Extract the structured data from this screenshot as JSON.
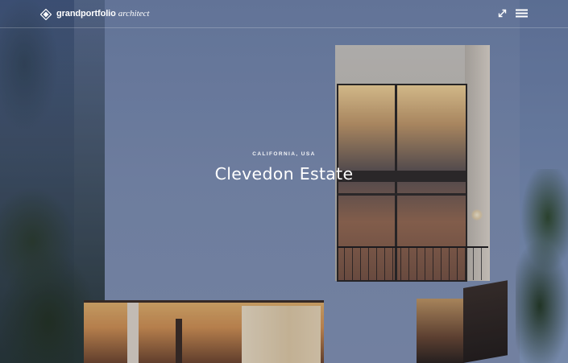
{
  "header": {
    "brand_name": "grandportfolio",
    "brand_suffix": "architect",
    "logo_icon": "diamond-logo-icon",
    "tools": [
      {
        "name": "fullscreen-icon",
        "label": "expand"
      },
      {
        "name": "menu-icon",
        "label": "menu"
      }
    ]
  },
  "hero": {
    "location": "CALIFORNIA, USA",
    "title": "Clevedon Estate"
  },
  "colors": {
    "text": "#ffffff",
    "divider": "rgba(255,255,255,0.22)"
  }
}
